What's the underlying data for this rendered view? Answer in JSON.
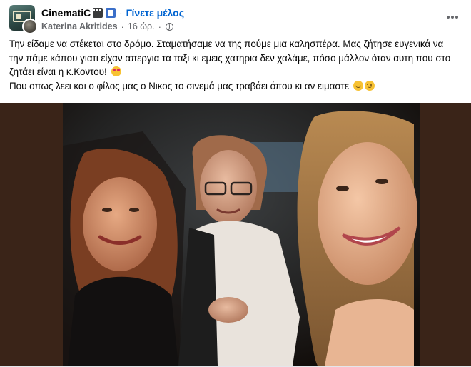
{
  "header": {
    "group_name": "CinematiC",
    "group_badges": [
      "clapper-board-icon",
      "framed-picture-icon"
    ],
    "separator": "·",
    "join_label": "Γίνετε μέλος",
    "author": "Katerina Akritides",
    "time": "16 ώρ.",
    "audience_icon": "globe-icon",
    "more_options_icon": "more-horizontal-icon"
  },
  "post": {
    "paragraph_1": "Την είδαμε να στέκεται στο δρόμο. Σταματήσαμε να της πούμε μια καλησπέρα. Μας ζήτησε ευγενικά να την πάμε κάπου γιατι είχαν απεργια τα ταξι κι εμεις χατηρια δεν χαλάμε, πόσο μάλλον όταν αυτη που στο ζητάει είναι η κ.Κοντου!",
    "paragraph_1_emoji": "heart-eyes-emoji",
    "paragraph_2": "Που οπως λεει και ο φίλος μας ο Νικος το σινεμά μας τραβάει όπου κι αν ειμαστε",
    "paragraph_2_emojis": [
      "smile-emoji",
      "wink-emoji"
    ]
  },
  "photo": {
    "type": "selfie",
    "subjects": 3
  },
  "colors": {
    "link": "#0064d1",
    "secondary_text": "#65676b",
    "primary_text": "#050505",
    "photo_backdrop": "#3a2418"
  }
}
